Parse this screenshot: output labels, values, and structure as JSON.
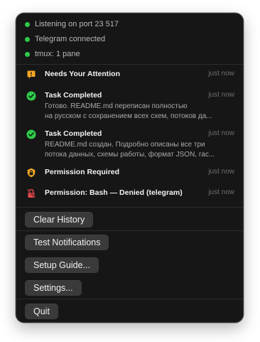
{
  "status": [
    {
      "text": "Listening on port 23 517",
      "color": "#30c94b"
    },
    {
      "text": "Telegram connected",
      "color": "#30c94b"
    },
    {
      "text": "tmux: 1 pane",
      "color": "#30c94b"
    }
  ],
  "notifications": [
    {
      "icon": "exclamation-badge-icon",
      "title": "Needs Your Attention",
      "time": "just now",
      "lines": []
    },
    {
      "icon": "checkmark-circle-icon",
      "title": "Task Completed",
      "time": "just now",
      "lines": [
        "Готово. README.md переписан полностью",
        "на русском с сохранением всех схем, потоков да..."
      ]
    },
    {
      "icon": "checkmark-circle-icon",
      "title": "Task Completed",
      "time": "just now",
      "lines": [
        "README.md создан. Подробно описаны все три",
        "потока данных, схемы работы, формат JSON, гас..."
      ]
    },
    {
      "icon": "lock-shield-icon",
      "title": "Permission Required",
      "time": "just now",
      "lines": []
    },
    {
      "icon": "denied-lock-icon",
      "title": "Permission: Bash — Denied (telegram)",
      "time": "just now",
      "lines": []
    }
  ],
  "actions": {
    "clear_history": "Clear History",
    "test_notifications": "Test Notifications",
    "setup_guide": "Setup Guide...",
    "settings": "Settings...",
    "quit": "Quit"
  },
  "colors": {
    "success": "#30c94b",
    "warning": "#f5a623",
    "danger": "#e5484d"
  }
}
